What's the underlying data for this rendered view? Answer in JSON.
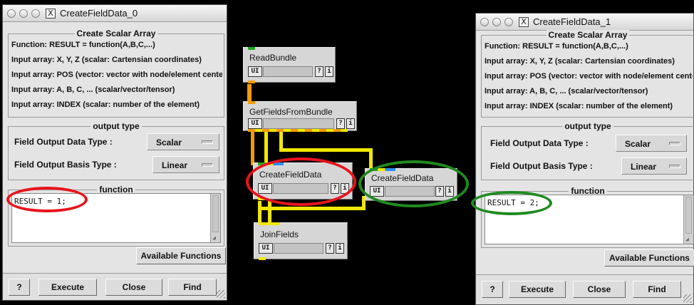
{
  "colors": {
    "desktop": "#000000",
    "wire_yellow": "#f0e800",
    "wire_orange": "#f59a0a",
    "port_green": "#22aa22",
    "port_blue": "#2b8cff",
    "highlight_red": "#e8141b",
    "highlight_green": "#1f8a1f"
  },
  "left_window": {
    "title": "CreateFieldData_0",
    "close_icon": "X",
    "scalar_group": {
      "title": "Create Scalar Array",
      "lines": [
        "Function: RESULT = function(A,B,C,...)",
        "Input array: X, Y, Z (scalar: Cartensian coordinates)",
        "Input array: POS (vector: vector with node/element center)",
        "Input array: A, B, C, ... (scalar/vector/tensor)",
        "Input array: INDEX (scalar: number of the element)"
      ]
    },
    "output_group": {
      "title": "output type",
      "data_type_label": "Field Output Data Type :",
      "data_type_value": "Scalar",
      "basis_type_label": "Field Output Basis Type :",
      "basis_type_value": "Linear"
    },
    "function_group": {
      "title": "function",
      "code": "RESULT = 1;"
    },
    "available_functions": "Available Functions",
    "buttons": {
      "help": "?",
      "execute": "Execute",
      "close": "Close",
      "find": "Find"
    }
  },
  "right_window": {
    "title": "CreateFieldData_1",
    "close_icon": "X",
    "scalar_group": {
      "title": "Create Scalar Array",
      "lines": [
        "Function: RESULT = function(A,B,C,...)",
        "Input array: X, Y, Z (scalar: Cartensian coordinates)",
        "Input array: POS (vector: vector with node/element center)",
        "Input array: A, B, C, ... (scalar/vector/tensor)",
        "Input array: INDEX (scalar: number of the element)"
      ]
    },
    "output_group": {
      "title": "output type",
      "data_type_label": "Field Output Data Type :",
      "data_type_value": "Scalar",
      "basis_type_label": "Field Output Basis Type :",
      "basis_type_value": "Linear"
    },
    "function_group": {
      "title": "function",
      "code": "RESULT = 2;"
    },
    "available_functions": "Available Functions",
    "buttons": {
      "help": "?",
      "execute": "Execute",
      "close": "Close",
      "find": "Find"
    }
  },
  "network": {
    "modules": {
      "read_bundle": "ReadBundle",
      "get_fields": "GetFieldsFromBundle",
      "create_0": "CreateFieldData",
      "create_1": "CreateFieldData",
      "join_fields": "JoinFields"
    },
    "ui_label": "UI",
    "q_label": "?",
    "i_label": "i"
  }
}
